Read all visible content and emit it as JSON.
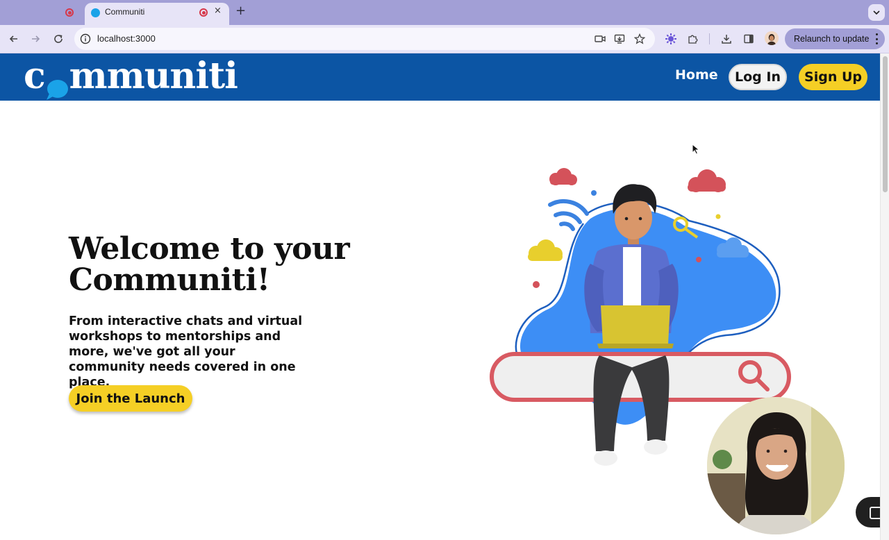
{
  "browser": {
    "tabs": [
      {
        "title": "",
        "active": false
      },
      {
        "title": "Communiti",
        "active": true
      }
    ],
    "close_glyph": "×",
    "new_tab_glyph": "+",
    "address": "localhost:3000",
    "relaunch_label": "Relaunch to update"
  },
  "header": {
    "logo_prefix": "c",
    "logo_rest": "mmuniti",
    "nav": {
      "home": "Home",
      "login": "Log In",
      "signup": "Sign Up"
    }
  },
  "hero": {
    "title_line1": "Welcome to your",
    "title_line2": "Communiti!",
    "subtitle": "From interactive chats and virtual workshops to mentorships and more, we've got all your community needs covered in one place.",
    "cta_label": "Join the Launch"
  },
  "colors": {
    "header_bg": "#0c55a4",
    "accent_yellow": "#f5cf25",
    "tabstrip": "#a29fd6",
    "blob_blue": "#3d8ef5",
    "search_red": "#d85a62",
    "recording_red": "#d6384a"
  },
  "icons": [
    "recording-icon",
    "back-icon",
    "forward-icon",
    "reload-icon",
    "site-info-icon",
    "camera-icon",
    "install-icon",
    "star-icon",
    "extension-icon",
    "puzzle-icon",
    "download-icon",
    "side-panel-icon",
    "profile-avatar",
    "menu-dots-icon",
    "chevron-down-icon",
    "search-icon",
    "wifi-icon",
    "cloud-icon"
  ]
}
